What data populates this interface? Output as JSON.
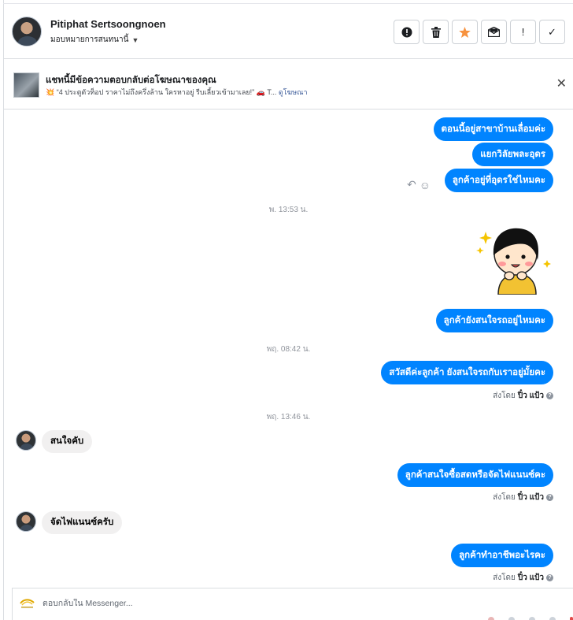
{
  "header": {
    "contact_name": "Pitiphat Sertsoongnoen",
    "assign_label": "มอบหมายการสนทนานี้",
    "actions": [
      {
        "name": "spam-button",
        "icon": "alert-circle-icon"
      },
      {
        "name": "delete-button",
        "icon": "trash-icon"
      },
      {
        "name": "follow-up-button",
        "icon": "star-icon"
      },
      {
        "name": "mark-unread-button",
        "icon": "envelope-icon"
      },
      {
        "name": "mark-important-button",
        "icon": "exclamation-icon",
        "glyph": "!"
      },
      {
        "name": "done-button",
        "icon": "check-icon",
        "glyph": "✓"
      }
    ]
  },
  "ad_banner": {
    "title": "แชทนี้มีข้อความตอบกลับต่อโฆษณาของคุณ",
    "subtitle": "💥 “4 ประตูตัวท็อป ราคาไม่ถึงครึ่งล้าน ใครหาอยู่ รีบเลี้ยวเข้ามาเลย!” 🚗 T...",
    "link": "ดูโฆษณา",
    "close_glyph": "✕"
  },
  "chat": {
    "messages": [
      {
        "side": "out",
        "text": "ตอนนี้อยู่สาขาบ้านเลื่อมค่ะ"
      },
      {
        "side": "out",
        "text": "แยกวิลัยพละอุดร"
      },
      {
        "side": "out",
        "text": "ลูกค้าอยู่ที่อุดรใช่ไหมคะ"
      },
      {
        "side": "time",
        "text": "พ. 13:53 น."
      },
      {
        "side": "sticker",
        "text": ""
      },
      {
        "side": "out",
        "text": "ลูกค้ายังสนใจรถอยู่ไหมคะ"
      },
      {
        "side": "time",
        "text": "พฤ. 08:42 น."
      },
      {
        "side": "out",
        "text": "สวัสดีค่ะลูกค้า ยังสนใจรถกับเราอยู่มั้ยคะ"
      },
      {
        "side": "time",
        "text": "พฤ. 13:46 น."
      },
      {
        "side": "in",
        "text": "สนใจคับ"
      },
      {
        "side": "out",
        "text": "ลูกค้าสนใจซื้อสดหรือจัดไฟแนนซ์คะ"
      },
      {
        "side": "in",
        "text": "จัดไฟแนนซ์ครับ"
      },
      {
        "side": "out",
        "text": "ลูกค้าทำอาชีพอะไรคะ"
      }
    ],
    "sent_by_prefix": "ส่งโดย",
    "sent_by_name": "ปิ๋ว แป้ว",
    "help_glyph": "?"
  },
  "composer": {
    "placeholder": "ตอบกลับใน Messenger..."
  },
  "colors": {
    "outgoing_bubble": "#0084ff",
    "incoming_bubble": "#f1f0f0",
    "follow_up_star": "#f7923e",
    "link": "#385898"
  }
}
